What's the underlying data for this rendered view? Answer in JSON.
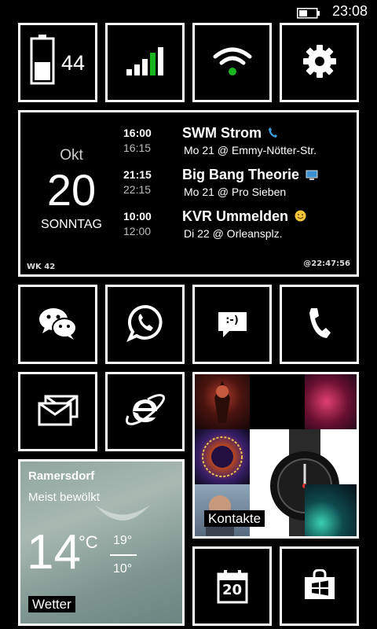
{
  "status": {
    "time": "23:08"
  },
  "battery_tile": {
    "level": "44",
    "fill_fraction": 0.45
  },
  "signal_tile": {
    "bars_filled": 4
  },
  "calendar_tile": {
    "month": "Okt",
    "day": "20",
    "weekday": "SONNTAG",
    "week": "WK 42",
    "updated": "@22:47:56",
    "events": [
      {
        "start": "16:00",
        "end": "16:15",
        "title": "SWM Strom",
        "icon": "phone-icon",
        "subtitle": "Mo 21 @ Emmy-Nötter-Str."
      },
      {
        "start": "21:15",
        "end": "22:15",
        "title": "Big Bang Theorie",
        "icon": "tv-icon",
        "subtitle": "Mo 21 @ Pro Sieben"
      },
      {
        "start": "10:00",
        "end": "12:00",
        "title": "KVR Ummelden",
        "icon": "smiley-icon",
        "subtitle": "Di 22 @ Orleansplz."
      }
    ]
  },
  "message_tile": {
    "text": ":-)"
  },
  "contacts_tile": {
    "label": "Kontakte"
  },
  "weather_tile": {
    "location": "Ramersdorf",
    "condition": "Meist bewölkt",
    "temp": "14",
    "unit": "°C",
    "high": "19°",
    "low": "10°",
    "label": "Wetter"
  },
  "store_calendar_tile": {
    "day": "20"
  },
  "colors": {
    "accent_green": "#19b51f",
    "background": "#000000",
    "border": "#ffffff",
    "phone_blue": "#3b9ddd"
  }
}
